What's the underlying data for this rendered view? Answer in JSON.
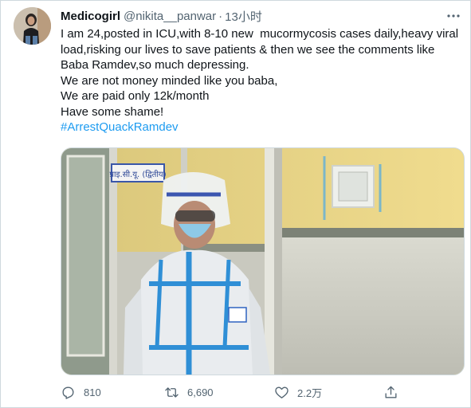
{
  "author": {
    "display_name": "Medicogirl",
    "handle": "@nikita__panwar",
    "separator": "·",
    "time": "13小时"
  },
  "tweet": {
    "lines": [
      "I am 24,posted in ICU,with 8-10 new  mucormycosis cases daily,heavy viral load,risking our lives to save patients & then we see the comments like Baba Ramdev,so much depressing.",
      "We are not money minded like you baba,",
      "We are paid only 12k/month",
      "Have some shame!"
    ],
    "hashtag": "#ArrestQuackRamdev"
  },
  "media": {
    "sign_text": "प्राइ.सी.यू. (द्वितीय)"
  },
  "actions": {
    "reply_count": "810",
    "retweet_count": "6,690",
    "like_count": "2.2万",
    "share_label": ""
  },
  "colors": {
    "accent": "#1d9bf0",
    "secondary_text": "#536471",
    "border": "#cfd9de"
  },
  "icons": [
    "more-icon",
    "reply-icon",
    "retweet-icon",
    "like-icon",
    "share-icon"
  ]
}
